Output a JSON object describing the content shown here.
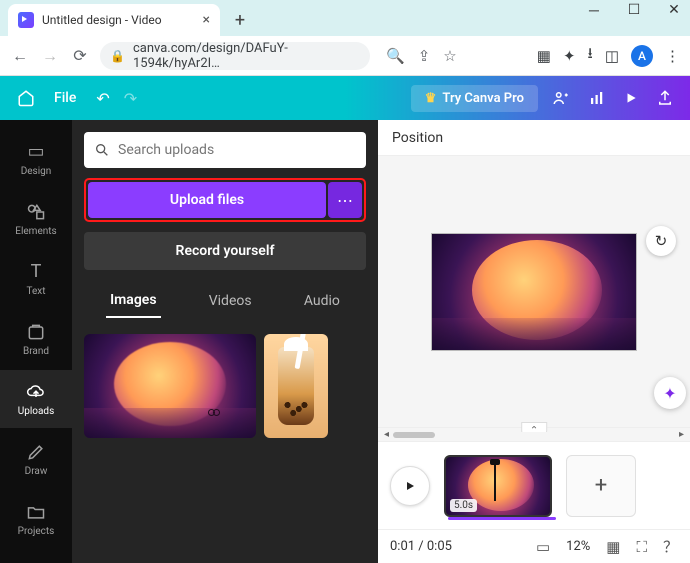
{
  "browser": {
    "tab_title": "Untitled design - Video",
    "url": "canva.com/design/DAFuY-1594k/hyAr2I…"
  },
  "canva_top": {
    "file_label": "File",
    "try_pro_label": "Try Canva Pro"
  },
  "rail": [
    {
      "id": "design",
      "label": "Design"
    },
    {
      "id": "elements",
      "label": "Elements"
    },
    {
      "id": "text",
      "label": "Text"
    },
    {
      "id": "brand",
      "label": "Brand"
    },
    {
      "id": "uploads",
      "label": "Uploads"
    },
    {
      "id": "draw",
      "label": "Draw"
    },
    {
      "id": "projects",
      "label": "Projects"
    }
  ],
  "panel": {
    "search_placeholder": "Search uploads",
    "upload_label": "Upload files",
    "record_label": "Record yourself",
    "tabs": [
      {
        "id": "images",
        "label": "Images",
        "active": true
      },
      {
        "id": "videos",
        "label": "Videos",
        "active": false
      },
      {
        "id": "audio",
        "label": "Audio",
        "active": false
      }
    ]
  },
  "canvas": {
    "position_label": "Position"
  },
  "timeline": {
    "clip_duration": "5.0s"
  },
  "footer": {
    "time_display": "0:01 / 0:05",
    "zoom_display": "12%"
  },
  "colors": {
    "accent": "#8b3dff",
    "teal": "#00c4cc",
    "highlight_border": "#ff1a1a"
  }
}
